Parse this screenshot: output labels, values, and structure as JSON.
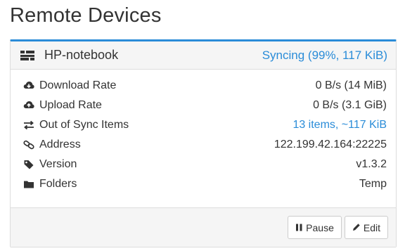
{
  "page": {
    "title": "Remote Devices"
  },
  "device": {
    "name": "HP-notebook",
    "status": "Syncing (99%, 117 KiB)",
    "accent_color": "#2a8cd8"
  },
  "details": [
    {
      "icon": "cloud-download-icon",
      "label": "Download Rate",
      "value": "0 B/s (14 MiB)",
      "link": false
    },
    {
      "icon": "cloud-upload-icon",
      "label": "Upload Rate",
      "value": "0 B/s (3.1 GiB)",
      "link": false
    },
    {
      "icon": "exchange-icon",
      "label": "Out of Sync Items",
      "value": "13 items, ~117 KiB",
      "link": true
    },
    {
      "icon": "link-icon",
      "label": "Address",
      "value": "122.199.42.164:22225",
      "link": false
    },
    {
      "icon": "tag-icon",
      "label": "Version",
      "value": "v1.3.2",
      "link": false
    },
    {
      "icon": "folder-icon",
      "label": "Folders",
      "value": "Temp",
      "link": false
    }
  ],
  "actions": {
    "pause_label": "Pause",
    "edit_label": "Edit"
  }
}
